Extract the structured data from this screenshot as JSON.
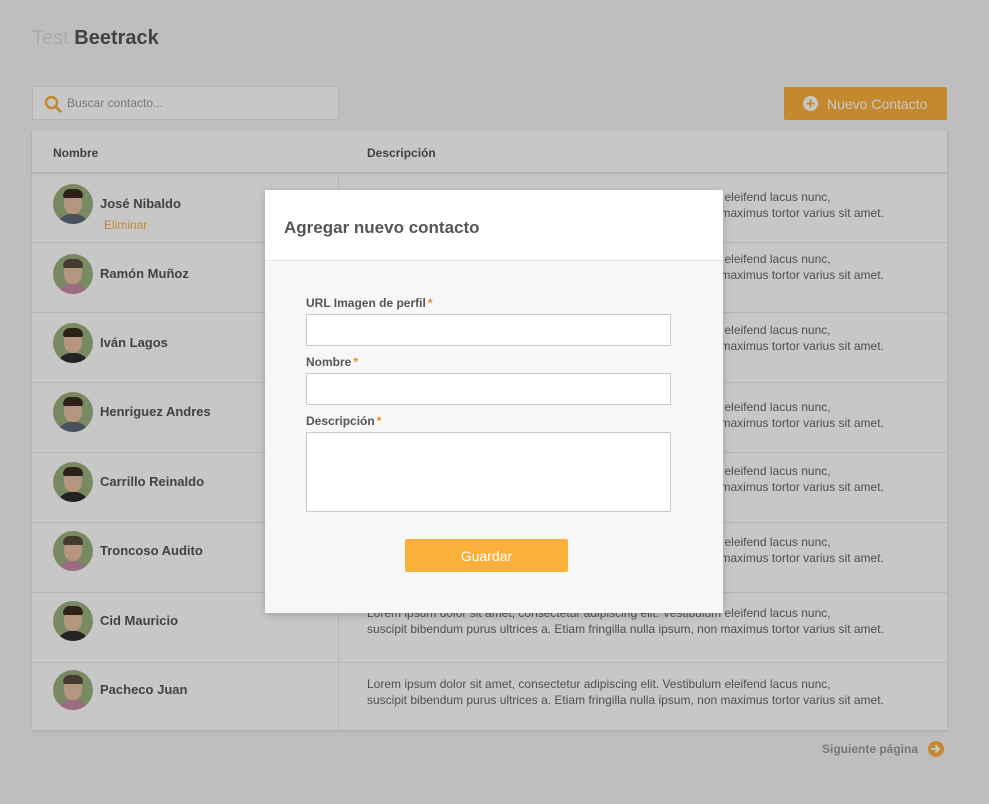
{
  "brand": {
    "prefix": "Test",
    "name": "Beetrack"
  },
  "search": {
    "placeholder": "Buscar contacto..."
  },
  "toolbar": {
    "new_contact_label": "Nuevo Contacto"
  },
  "table": {
    "columns": [
      "Nombre",
      "Descripción"
    ],
    "delete_label": "Eliminar",
    "rows": [
      {
        "name": "José Nibaldo",
        "desc1": "Lorem ipsum dolor sit amet, consectetur adipiscing elit. Vestibulum eleifend lacus nunc,",
        "desc2": "suscipit bibendum purus ultrices a. Etiam fringilla nulla ipsum, non maximus tortor varius sit amet."
      },
      {
        "name": "Ramón Muñoz",
        "desc1": "Lorem ipsum dolor sit amet, consectetur adipiscing elit. Vestibulum eleifend lacus nunc,",
        "desc2": "suscipit bibendum purus ultrices a. Etiam fringilla nulla ipsum, non maximus tortor varius sit amet."
      },
      {
        "name": "Iván Lagos",
        "desc1": "Lorem ipsum dolor sit amet, consectetur adipiscing elit. Vestibulum eleifend lacus nunc,",
        "desc2": "suscipit bibendum purus ultrices a. Etiam fringilla nulla ipsum, non maximus tortor varius sit amet."
      },
      {
        "name": "Henriguez Andres",
        "desc1": "Lorem ipsum dolor sit amet, consectetur adipiscing elit. Vestibulum eleifend lacus nunc,",
        "desc2": "suscipit bibendum purus ultrices a. Etiam fringilla nulla ipsum, non maximus tortor varius sit amet."
      },
      {
        "name": "Carrillo Reinaldo",
        "desc1": "Lorem ipsum dolor sit amet, consectetur adipiscing elit. Vestibulum eleifend lacus nunc,",
        "desc2": "suscipit bibendum purus ultrices a. Etiam fringilla nulla ipsum, non maximus tortor varius sit amet."
      },
      {
        "name": "Troncoso Audito",
        "desc1": "Lorem ipsum dolor sit amet, consectetur adipiscing elit. Vestibulum eleifend lacus nunc,",
        "desc2": "suscipit bibendum purus ultrices a. Etiam fringilla nulla ipsum, non maximus tortor varius sit amet."
      },
      {
        "name": "Cid Mauricio",
        "desc1": "Lorem ipsum dolor sit amet, consectetur adipiscing elit. Vestibulum eleifend lacus nunc,",
        "desc2": "suscipit bibendum purus ultrices a. Etiam fringilla nulla ipsum, non maximus tortor varius sit amet."
      },
      {
        "name": "Pacheco Juan",
        "desc1": "Lorem ipsum dolor sit amet, consectetur adipiscing elit. Vestibulum eleifend lacus nunc,",
        "desc2": "suscipit bibendum purus ultrices a. Etiam fringilla nulla ipsum, non maximus tortor varius sit amet."
      }
    ]
  },
  "modal": {
    "title": "Agregar nuevo contacto",
    "fields": [
      {
        "label": "URL Imagen de perfil",
        "required": "*"
      },
      {
        "label": "Nombre",
        "required": "*"
      },
      {
        "label": "Descripción",
        "required": "*"
      }
    ],
    "save_label": "Guardar"
  },
  "pagination": {
    "next_label": "Siguiente página"
  },
  "colors": {
    "accent": "#fbb03b",
    "required": "#f08a24",
    "text": "#555555"
  },
  "icons": {
    "search": "search-icon",
    "add": "plus-circle-icon",
    "next": "arrow-right-circle-icon"
  }
}
